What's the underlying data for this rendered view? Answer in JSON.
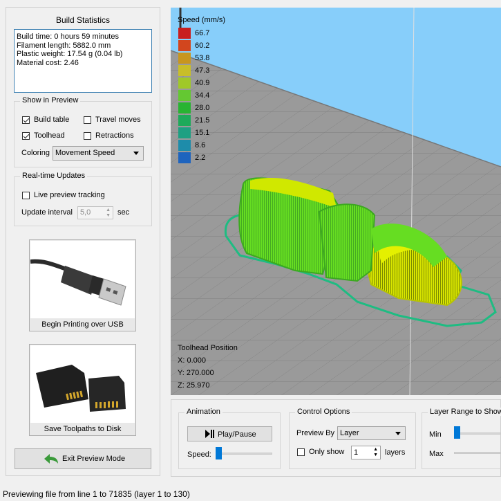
{
  "build_statistics": {
    "title": "Build Statistics",
    "lines": [
      "Build time: 0 hours 59 minutes",
      "Filament length: 5882.0 mm",
      "Plastic weight: 17.54 g (0.04 lb)",
      "Material cost: 2.46"
    ]
  },
  "show_in_preview": {
    "title": "Show in Preview",
    "build_table": {
      "label": "Build table",
      "checked": true
    },
    "travel_moves": {
      "label": "Travel moves",
      "checked": false
    },
    "toolhead": {
      "label": "Toolhead",
      "checked": true
    },
    "retractions": {
      "label": "Retractions",
      "checked": false
    },
    "coloring_label": "Coloring",
    "coloring_value": "Movement Speed"
  },
  "realtime_updates": {
    "title": "Real-time Updates",
    "live_preview": {
      "label": "Live preview tracking",
      "checked": false
    },
    "update_interval_label": "Update interval",
    "update_interval_value": "5,0",
    "unit": "sec"
  },
  "usb_button": {
    "label": "Begin Printing over USB"
  },
  "disk_button": {
    "label": "Save Toolpaths to Disk"
  },
  "exit_button": {
    "label": "Exit Preview Mode"
  },
  "viewport": {
    "legend_title": "Speed (mm/s)",
    "legend": [
      {
        "value": "66.7",
        "color": "#c81e1e"
      },
      {
        "value": "60.2",
        "color": "#d2461e"
      },
      {
        "value": "53.8",
        "color": "#c8961e"
      },
      {
        "value": "47.3",
        "color": "#c8be28"
      },
      {
        "value": "40.9",
        "color": "#a0c828"
      },
      {
        "value": "34.4",
        "color": "#64c832"
      },
      {
        "value": "28.0",
        "color": "#28b432"
      },
      {
        "value": "21.5",
        "color": "#1eaa5a"
      },
      {
        "value": "15.1",
        "color": "#1ea082"
      },
      {
        "value": "8.6",
        "color": "#1e8caa"
      },
      {
        "value": "2.2",
        "color": "#1e64be"
      }
    ],
    "toolhead_position": {
      "title": "Toolhead Position",
      "x": "X: 0.000",
      "y": "Y: 270.000",
      "z": "Z: 25.970"
    }
  },
  "animation": {
    "title": "Animation",
    "play_pause_label": "Play/Pause",
    "speed_label": "Speed:"
  },
  "control_options": {
    "title": "Control Options",
    "preview_by_label": "Preview By",
    "preview_by_value": "Layer",
    "only_show_label": "Only show",
    "only_show_checked": false,
    "layers_value": "1",
    "layers_label": "layers"
  },
  "layer_range": {
    "title": "Layer Range to Show",
    "min_label": "Min",
    "max_label": "Max"
  },
  "status_bar": {
    "text": "Previewing file from line 1 to 71835 (layer 1 to 130)"
  }
}
